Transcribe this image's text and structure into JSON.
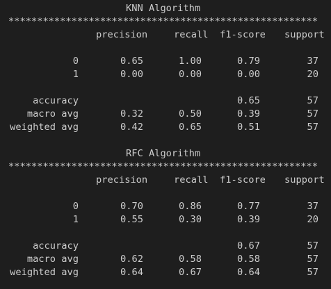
{
  "terminal": {
    "separator": "******************************************************",
    "headers": {
      "precision": "precision",
      "recall": "recall",
      "f1": "f1-score",
      "support": "support"
    },
    "reports": [
      {
        "title": "KNN Algorithm",
        "rows": [
          {
            "label": "0",
            "precision": "0.65",
            "recall": "1.00",
            "f1": "0.79",
            "support": "37"
          },
          {
            "label": "1",
            "precision": "0.00",
            "recall": "0.00",
            "f1": "0.00",
            "support": "20"
          }
        ],
        "accuracy": {
          "label": "accuracy",
          "f1": "0.65",
          "support": "57"
        },
        "macro": {
          "label": "macro avg",
          "precision": "0.32",
          "recall": "0.50",
          "f1": "0.39",
          "support": "57"
        },
        "weighted": {
          "label": "weighted avg",
          "precision": "0.42",
          "recall": "0.65",
          "f1": "0.51",
          "support": "57"
        }
      },
      {
        "title": "RFC Algorithm",
        "rows": [
          {
            "label": "0",
            "precision": "0.70",
            "recall": "0.86",
            "f1": "0.77",
            "support": "37"
          },
          {
            "label": "1",
            "precision": "0.55",
            "recall": "0.30",
            "f1": "0.39",
            "support": "20"
          }
        ],
        "accuracy": {
          "label": "accuracy",
          "f1": "0.67",
          "support": "57"
        },
        "macro": {
          "label": "macro avg",
          "precision": "0.62",
          "recall": "0.58",
          "f1": "0.58",
          "support": "57"
        },
        "weighted": {
          "label": "weighted avg",
          "precision": "0.64",
          "recall": "0.67",
          "f1": "0.64",
          "support": "57"
        }
      }
    ]
  }
}
